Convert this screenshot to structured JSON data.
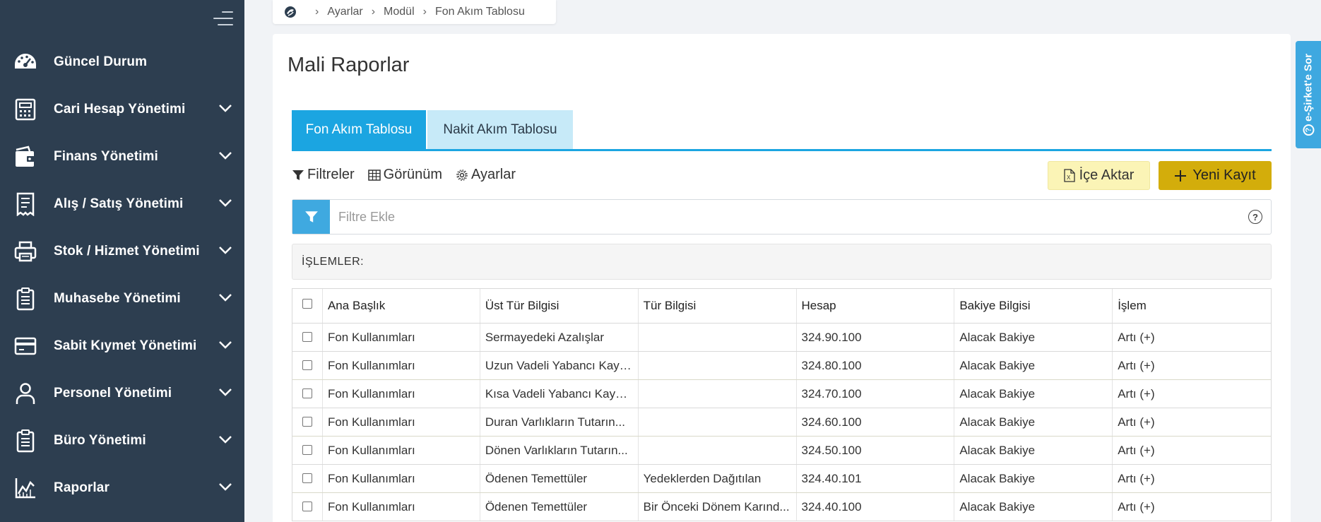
{
  "sidebar": {
    "items": [
      {
        "label": "Güncel Durum",
        "icon": "dashboard-icon",
        "expandable": false
      },
      {
        "label": "Cari Hesap Yönetimi",
        "icon": "calculator-icon",
        "expandable": true
      },
      {
        "label": "Finans Yönetimi",
        "icon": "wallet-icon",
        "expandable": true
      },
      {
        "label": "Alış / Satış Yönetimi",
        "icon": "receipt-icon",
        "expandable": true
      },
      {
        "label": "Stok / Hizmet Yönetimi",
        "icon": "printer-icon",
        "expandable": true
      },
      {
        "label": "Muhasebe Yönetimi",
        "icon": "clipboard-icon",
        "expandable": true
      },
      {
        "label": "Sabit Kıymet Yönetimi",
        "icon": "credit-card-icon",
        "expandable": true
      },
      {
        "label": "Personel Yönetimi",
        "icon": "user-icon",
        "expandable": true
      },
      {
        "label": "Büro Yönetimi",
        "icon": "clipboard-list-icon",
        "expandable": true
      },
      {
        "label": "Raporlar",
        "icon": "chart-icon",
        "expandable": true
      }
    ]
  },
  "breadcrumb": {
    "items": [
      "Ayarlar",
      "Modül",
      "Fon Akım Tablosu"
    ]
  },
  "page": {
    "title": "Mali Raporlar"
  },
  "tabs": [
    {
      "label": "Fon Akım Tablosu",
      "active": true
    },
    {
      "label": "Nakit Akım Tablosu",
      "active": false
    }
  ],
  "toolbar": {
    "filters": "Filtreler",
    "view": "Görünüm",
    "settings": "Ayarlar",
    "import": "İçe Aktar",
    "new_record": "Yeni Kayıt"
  },
  "filter": {
    "placeholder": "Filtre Ekle",
    "help": "?"
  },
  "operations": {
    "label": "İŞLEMLER:"
  },
  "table": {
    "columns": [
      "Ana Başlık",
      "Üst Tür Bilgisi",
      "Tür Bilgisi",
      "Hesap",
      "Bakiye Bilgisi",
      "İşlem"
    ],
    "rows": [
      [
        "Fon Kullanımları",
        "Sermayedeki Azalışlar",
        "",
        "324.90.100",
        "Alacak Bakiye",
        "Artı (+)"
      ],
      [
        "Fon Kullanımları",
        "Uzun Vadeli Yabancı Kayn...",
        "",
        "324.80.100",
        "Alacak Bakiye",
        "Artı (+)"
      ],
      [
        "Fon Kullanımları",
        "Kısa Vadeli Yabancı Kayna...",
        "",
        "324.70.100",
        "Alacak Bakiye",
        "Artı (+)"
      ],
      [
        "Fon Kullanımları",
        "Duran Varlıkların Tutarın...",
        "",
        "324.60.100",
        "Alacak Bakiye",
        "Artı (+)"
      ],
      [
        "Fon Kullanımları",
        "Dönen Varlıkların Tutarın...",
        "",
        "324.50.100",
        "Alacak Bakiye",
        "Artı (+)"
      ],
      [
        "Fon Kullanımları",
        "Ödenen Temettüler",
        "Yedeklerden Dağıtılan",
        "324.40.101",
        "Alacak Bakiye",
        "Artı (+)"
      ],
      [
        "Fon Kullanımları",
        "Ödenen Temettüler",
        "Bir Önceki Dönem Karınd...",
        "324.40.100",
        "Alacak Bakiye",
        "Artı (+)"
      ]
    ]
  },
  "help_tab": {
    "label": "e-Şirket'e Sor",
    "icon_text": "?"
  },
  "colors": {
    "sidebar_bg": "#2d3e50",
    "accent": "#1ba5e1",
    "tab_inactive": "#c7eaf8",
    "import_btn": "#fbf4b6",
    "new_btn": "#d3ad0b"
  }
}
